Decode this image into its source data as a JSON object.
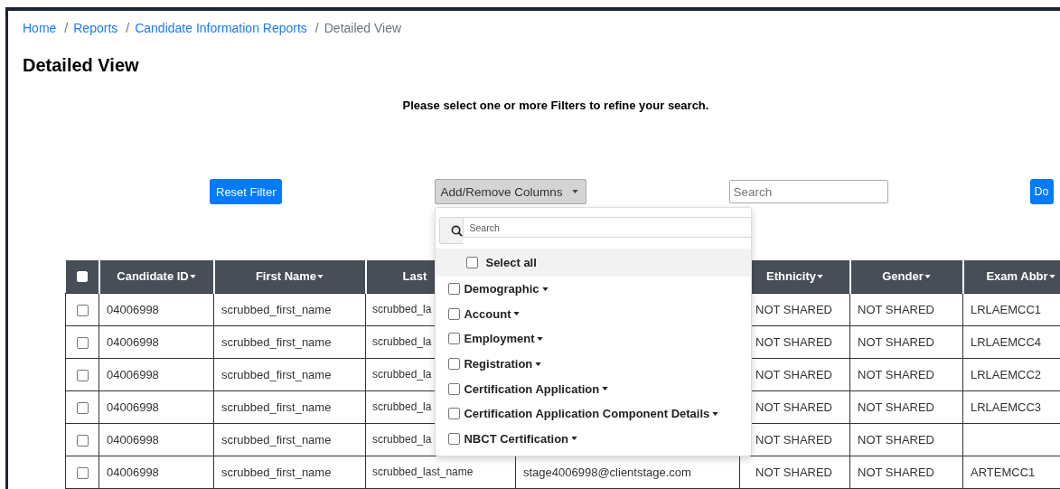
{
  "breadcrumb": [
    {
      "label": "Home",
      "current": false
    },
    {
      "separator": "/",
      "label": "Reports",
      "current": false
    },
    {
      "separator": "/",
      "label": "Candidate Information Reports",
      "current": false
    },
    {
      "separator": "/",
      "label": "Detailed View",
      "current": true
    }
  ],
  "page_title": "Detailed View",
  "notice": "Please select one or more Filters to refine your search.",
  "toolbar": {
    "reset_button": "Reset Filter",
    "columns_button": "Add/Remove Columns",
    "search": {
      "placeholder": "Search"
    },
    "download_button": "Do"
  },
  "columns_menu": {
    "open": true,
    "search": {
      "placeholder": "Search"
    },
    "select_all": {
      "label": "Select all",
      "checked": false
    },
    "groups": [
      {
        "label": "Demographic",
        "checked": false
      },
      {
        "label": "Account",
        "checked": false
      },
      {
        "label": "Employment",
        "checked": false
      },
      {
        "label": "Registration",
        "checked": false
      },
      {
        "label": "Certification Application",
        "checked": false
      },
      {
        "label": "Certification Application Component Details",
        "checked": false
      },
      {
        "label": "NBCT Certification",
        "checked": false
      }
    ]
  },
  "table": {
    "header_checkbox": {
      "checked": false
    },
    "columns": [
      {
        "label": "Candidate ID",
        "caret": true
      },
      {
        "label": "First Name",
        "caret": true
      },
      {
        "label": "Last",
        "caret": false
      },
      null,
      {
        "label": "Ethnicity",
        "caret": true
      },
      {
        "label": "Gender",
        "caret": true
      },
      {
        "label": "Exam Abbr",
        "caret": true
      }
    ],
    "rows": [
      {
        "selected": false,
        "cells": [
          "04006998",
          "scrubbed_first_name",
          "scrubbed_la",
          null,
          "NOT SHARED",
          "NOT SHARED",
          "LRLAEMCC1"
        ]
      },
      {
        "selected": false,
        "cells": [
          "04006998",
          "scrubbed_first_name",
          "scrubbed_la",
          null,
          "NOT SHARED",
          "NOT SHARED",
          "LRLAEMCC4"
        ]
      },
      {
        "selected": false,
        "cells": [
          "04006998",
          "scrubbed_first_name",
          "scrubbed_la",
          null,
          "NOT SHARED",
          "NOT SHARED",
          "LRLAEMCC2"
        ]
      },
      {
        "selected": false,
        "cells": [
          "04006998",
          "scrubbed_first_name",
          "scrubbed_la",
          null,
          "NOT SHARED",
          "NOT SHARED",
          "LRLAEMCC3"
        ]
      },
      {
        "selected": false,
        "cells": [
          "04006998",
          "scrubbed_first_name",
          "scrubbed_la",
          null,
          "NOT SHARED",
          "NOT SHARED",
          null
        ]
      },
      {
        "selected": false,
        "cells": [
          "04006998",
          "scrubbed_first_name",
          "scrubbed_last_name",
          "stage4006998@clientstage.com",
          "NOT SHARED",
          "NOT SHARED",
          "ARTEMCC1"
        ]
      }
    ]
  }
}
